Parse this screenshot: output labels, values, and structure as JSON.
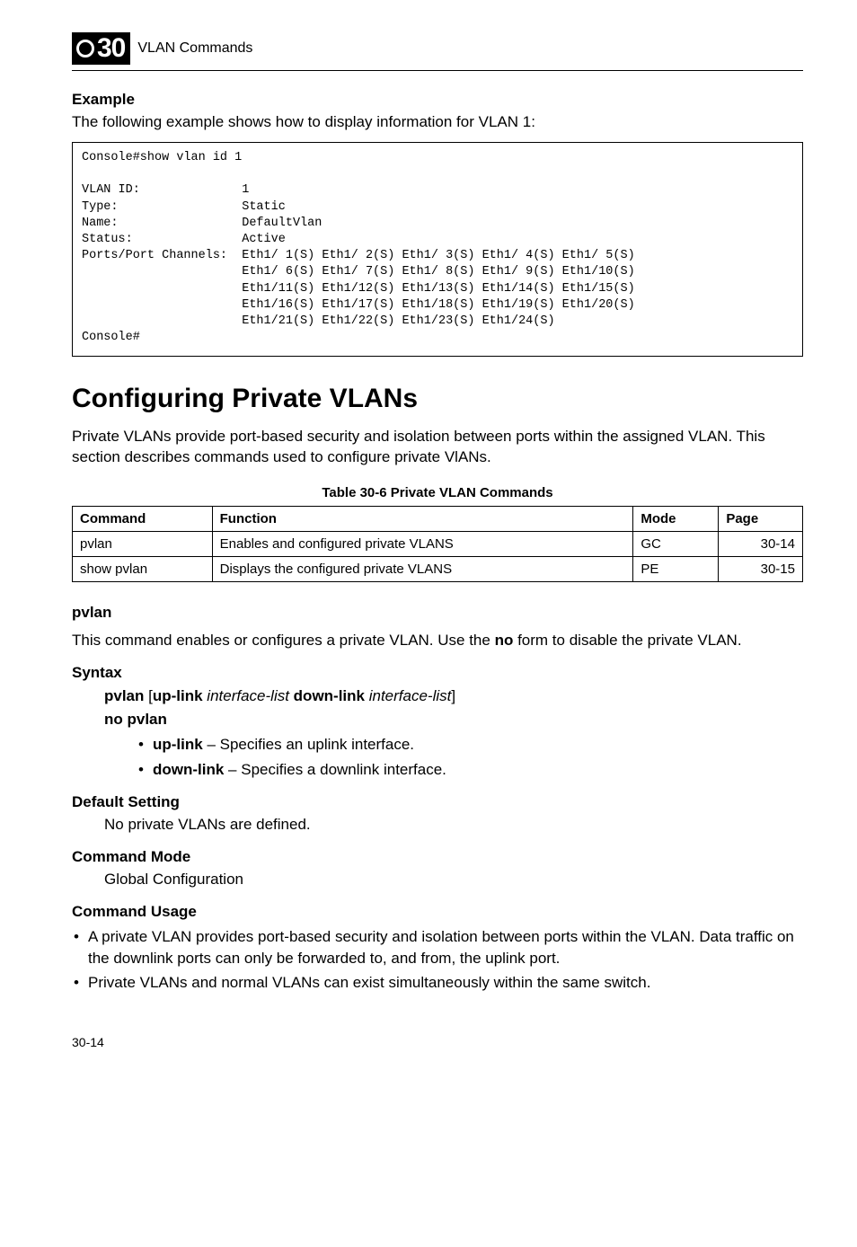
{
  "header": {
    "chapter_number": "30",
    "chapter_title": "VLAN Commands"
  },
  "example": {
    "heading": "Example",
    "intro": "The following example shows how to display information for VLAN 1:",
    "code": "Console#show vlan id 1\n\nVLAN ID:              1\nType:                 Static\nName:                 DefaultVlan\nStatus:               Active\nPorts/Port Channels:  Eth1/ 1(S) Eth1/ 2(S) Eth1/ 3(S) Eth1/ 4(S) Eth1/ 5(S)\n                      Eth1/ 6(S) Eth1/ 7(S) Eth1/ 8(S) Eth1/ 9(S) Eth1/10(S)\n                      Eth1/11(S) Eth1/12(S) Eth1/13(S) Eth1/14(S) Eth1/15(S)\n                      Eth1/16(S) Eth1/17(S) Eth1/18(S) Eth1/19(S) Eth1/20(S)\n                      Eth1/21(S) Eth1/22(S) Eth1/23(S) Eth1/24(S)\nConsole#"
  },
  "section": {
    "title": "Configuring Private VLANs",
    "intro": "Private VLANs provide port-based security and isolation between ports within the assigned VLAN. This section describes commands used to configure private VlANs."
  },
  "table": {
    "caption": "Table 30-6   Private VLAN Commands",
    "headers": {
      "command": "Command",
      "function": "Function",
      "mode": "Mode",
      "page": "Page"
    },
    "rows": [
      {
        "command": "pvlan",
        "function": "Enables and configured private VLANS",
        "mode": "GC",
        "page": "30-14"
      },
      {
        "command": "show pvlan",
        "function": "Displays the configured private VLANS",
        "mode": "PE",
        "page": "30-15"
      }
    ]
  },
  "pvlan": {
    "heading": "pvlan",
    "desc_pre": "This command enables or configures a private VLAN. Use the ",
    "desc_bold": "no",
    "desc_post": " form to disable the private VLAN.",
    "syntax_heading": "Syntax",
    "syntax": {
      "b1": "pvlan",
      "plain1": " [",
      "b2": "up-link",
      "i1": " interface-list ",
      "b3": "down-link",
      "i2": " interface-list",
      "plain2": "]",
      "line2_b": "no pvlan"
    },
    "bullets_syntax": [
      {
        "b": "up-link",
        "rest": " – Specifies an uplink interface."
      },
      {
        "b": "down-link",
        "rest": " – Specifies a downlink interface."
      }
    ],
    "default_heading": "Default Setting",
    "default_text": "No private VLANs are defined.",
    "mode_heading": "Command Mode",
    "mode_text": "Global Configuration",
    "usage_heading": "Command Usage",
    "usage_bullets": [
      "A private VLAN provides port-based security and isolation between ports within the VLAN. Data traffic on the downlink ports can only be forwarded to, and from, the uplink port.",
      "Private VLANs and normal VLANs can exist simultaneously within the same switch."
    ]
  },
  "footer": {
    "page": "30-14"
  }
}
